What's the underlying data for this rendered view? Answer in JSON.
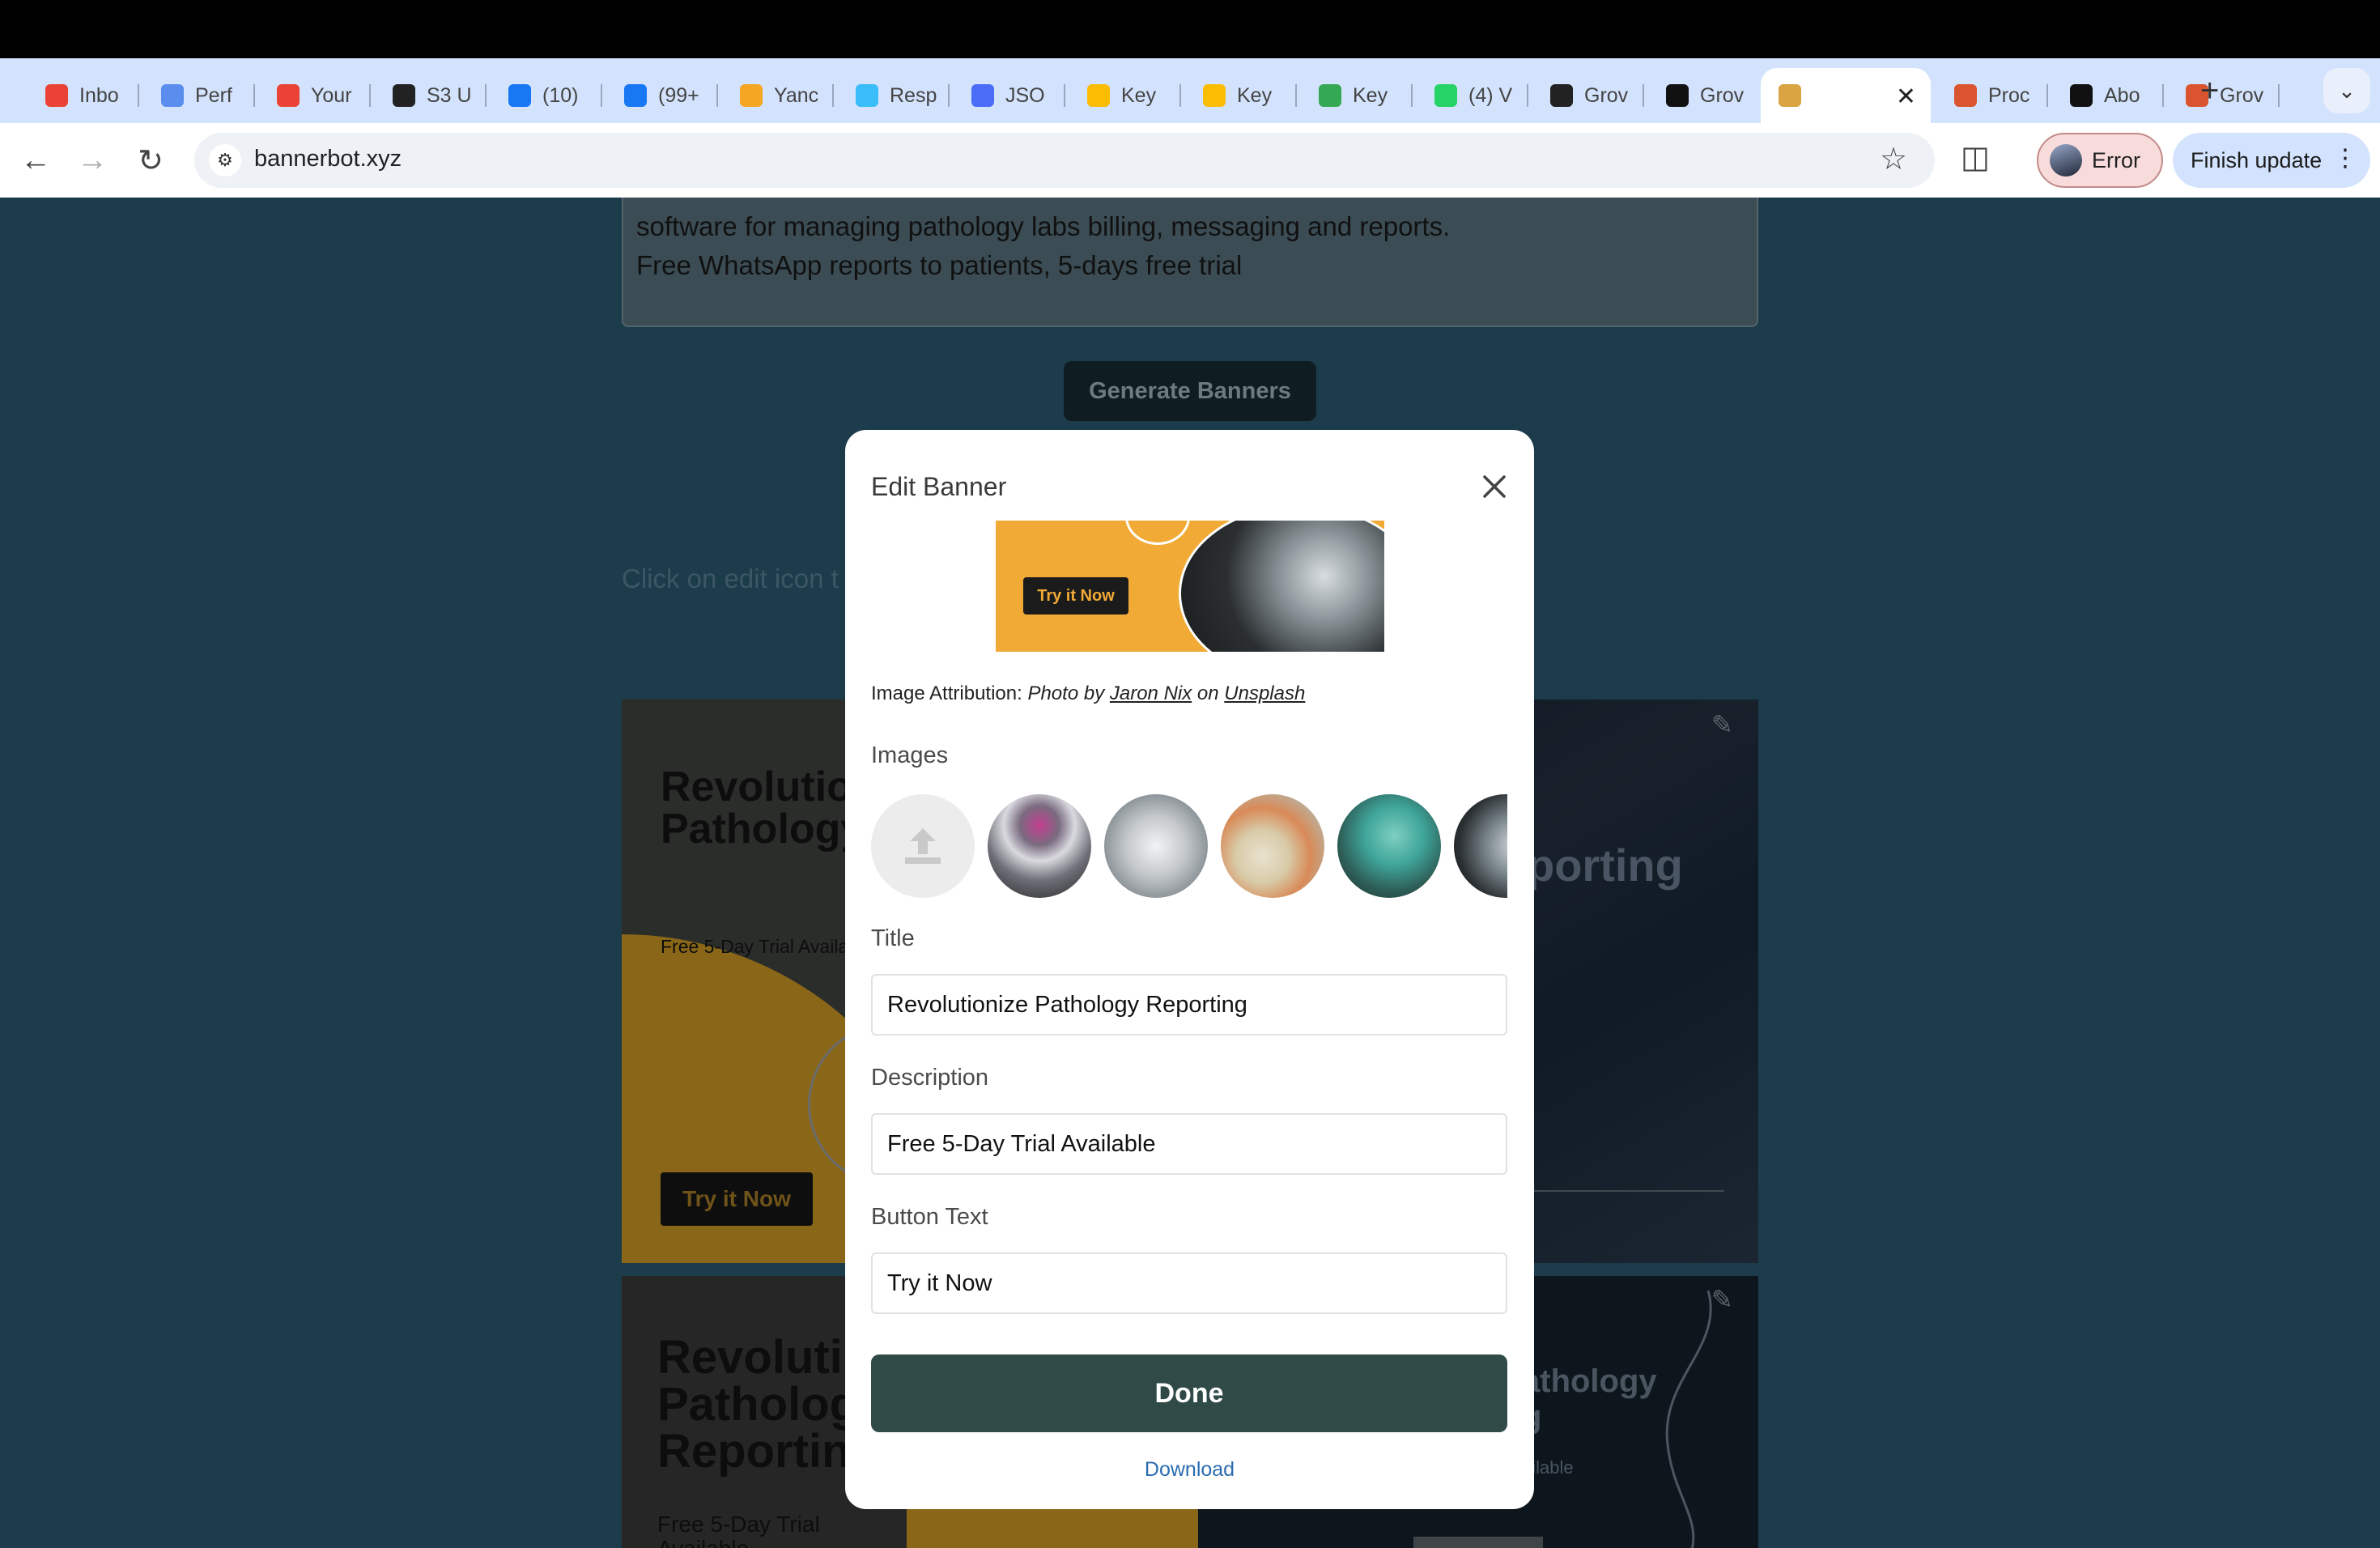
{
  "browser": {
    "tabs": [
      {
        "label": "Inbo",
        "icon": "gmail-icon",
        "color": "#ea4335"
      },
      {
        "label": "Perf",
        "icon": "analytics-icon",
        "color": "#5b8def"
      },
      {
        "label": "Your",
        "icon": "gmail-icon",
        "color": "#ea4335"
      },
      {
        "label": "S3 U",
        "icon": "openai-icon",
        "color": "#222222"
      },
      {
        "label": "(10)",
        "icon": "meta-icon",
        "color": "#1877f2"
      },
      {
        "label": "(99+",
        "icon": "meta-icon",
        "color": "#1877f2"
      },
      {
        "label": "Yanc",
        "icon": "yandex-icon",
        "color": "#f5a623"
      },
      {
        "label": "Resp",
        "icon": "tailwind-icon",
        "color": "#38bdf8"
      },
      {
        "label": "JSO",
        "icon": "json-icon",
        "color": "#4a6cf7"
      },
      {
        "label": "Key",
        "icon": "google-ads-icon",
        "color": "#fbbc04"
      },
      {
        "label": "Key",
        "icon": "google-ads-icon",
        "color": "#fbbc04"
      },
      {
        "label": "Key",
        "icon": "globe-icon",
        "color": "#34a853"
      },
      {
        "label": "(4) V",
        "icon": "whatsapp-icon",
        "color": "#25d366"
      },
      {
        "label": "Grov",
        "icon": "openai-icon",
        "color": "#222222"
      },
      {
        "label": "Grov",
        "icon": "app-icon",
        "color": "#111111"
      },
      {
        "label": "",
        "icon": "bannerbot-icon",
        "color": "#d9a441",
        "active": true
      },
      {
        "label": "Proc",
        "icon": "producthunt-icon",
        "color": "#da552f"
      },
      {
        "label": "Abo",
        "icon": "app-icon",
        "color": "#111111"
      },
      {
        "label": "Grov",
        "icon": "producthunt-icon",
        "color": "#da552f"
      }
    ],
    "url": "bannerbot.xyz",
    "profile_status": "Error",
    "update_button": "Finish update"
  },
  "page": {
    "prompt_lines": [
      "software for managing pathology labs billing, messaging and reports.",
      "Free WhatsApp reports to patients, 5-days free trial"
    ],
    "generate_button": "Generate Banners",
    "hint": "Click on edit icon t",
    "cards": [
      {
        "title_lines": [
          "Revolutio",
          "Pathology"
        ],
        "description": "Free 5-Day Trial Availa",
        "button": "Try it Now",
        "right_title": "porting"
      },
      {
        "title_lines": [
          "Revoluti",
          "Patholog",
          "Reportin"
        ],
        "description_lines": [
          "Free 5-Day Trial",
          "Available"
        ],
        "right_title_lines": [
          "athology",
          "g"
        ],
        "right_description": "ailable"
      }
    ]
  },
  "modal": {
    "title": "Edit Banner",
    "preview": {
      "button": "Try it Now",
      "accent": "#f1aa36"
    },
    "attribution": {
      "prefix": "Image Attribution:",
      "photo_by": "Photo by",
      "author": "Jaron Nix",
      "on": "on",
      "source": "Unsplash"
    },
    "images_label": "Images",
    "fields": {
      "title_label": "Title",
      "title_value": "Revolutionize Pathology Reporting",
      "description_label": "Description",
      "description_value": "Free 5-Day Trial Available",
      "button_label": "Button Text",
      "button_value": "Try it Now"
    },
    "done_button": "Done",
    "download_link": "Download"
  }
}
